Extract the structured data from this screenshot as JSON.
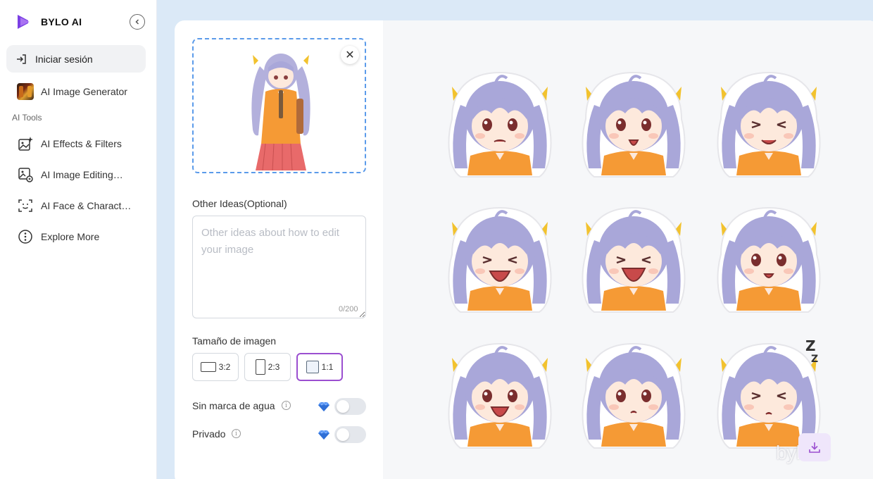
{
  "brand": {
    "name": "BYLO AI",
    "accent": "#7b3fe4"
  },
  "sidebar": {
    "login_label": "Iniciar sesión",
    "generator_label": "AI Image Generator",
    "section_label": "AI Tools",
    "items": [
      {
        "label": "AI Effects & Filters",
        "icon": "image-sparkle-icon"
      },
      {
        "label": "AI Image Editing…",
        "icon": "image-edit-icon"
      },
      {
        "label": "AI Face & Charact…",
        "icon": "face-scan-icon"
      },
      {
        "label": "Explore More",
        "icon": "more-dots-icon"
      }
    ]
  },
  "form": {
    "other_ideas_label": "Other Ideas(Optional)",
    "other_ideas_placeholder": "Other ideas about how to edit your image",
    "other_ideas_value": "",
    "counter": "0/200",
    "size_label": "Tamaño de imagen",
    "ratios": [
      {
        "label": "3:2",
        "selected": false
      },
      {
        "label": "2:3",
        "selected": false
      },
      {
        "label": "1:1",
        "selected": true
      }
    ],
    "no_watermark_label": "Sin marca de agua",
    "no_watermark_on": false,
    "private_label": "Privado",
    "private_on": false
  },
  "preview": {
    "watermark": "bylo.ai",
    "sticker_count": 9,
    "colors": {
      "hair": "#a9a7d9",
      "shirt": "#f59a35",
      "ribbon": "#f2c22e",
      "selected_border": "#9b4fd0",
      "dashed_border": "#5b9bea"
    }
  }
}
